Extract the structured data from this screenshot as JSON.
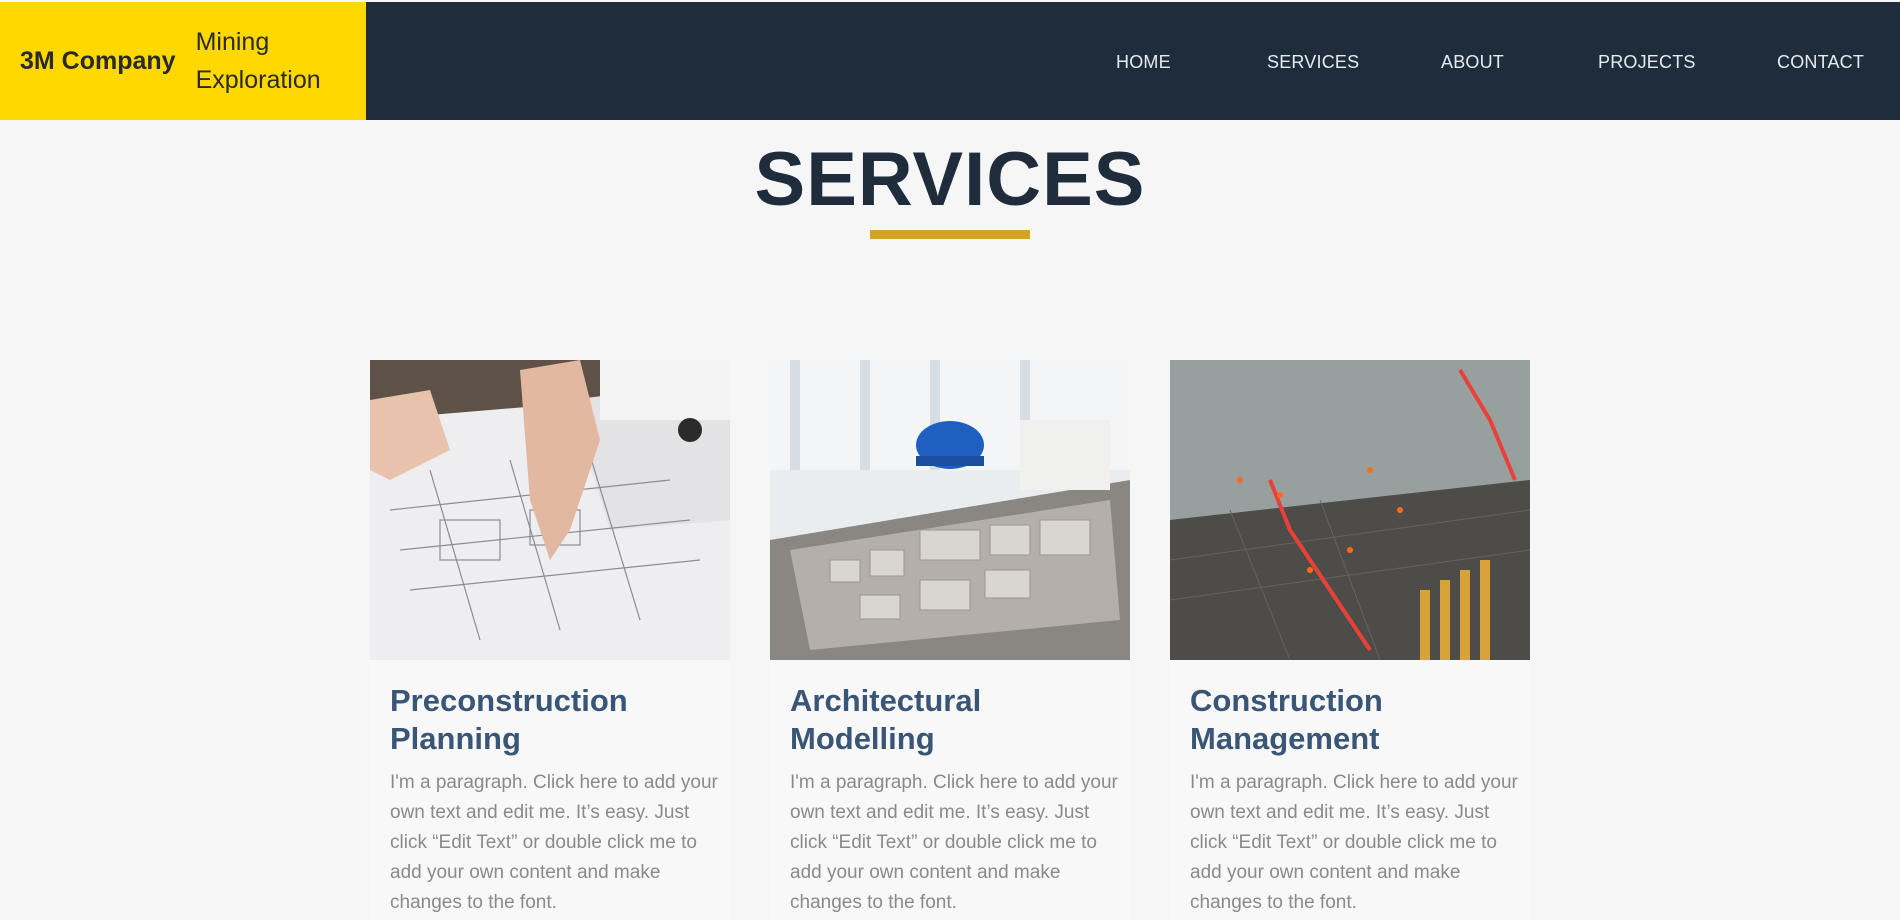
{
  "brand": {
    "name": "3M Company",
    "tagline": "Mining\nExploration"
  },
  "nav": {
    "items": [
      "HOME",
      "SERVICES",
      "ABOUT",
      "PROJECTS",
      "CONTACT"
    ]
  },
  "page": {
    "title": "SERVICES"
  },
  "cards": [
    {
      "title": "Preconstruction\nPlanning",
      "text": "I'm a paragraph. Click here to add your own text and edit me. It’s easy. Just click “Edit Text” or double click me to add your own content and make changes to the font."
    },
    {
      "title": "Architectural\nModelling",
      "text": "I'm a paragraph. Click here to add your own text and edit me. It’s easy. Just click “Edit Text” or double click me to add your own content and make changes to the font."
    },
    {
      "title": "Construction\nManagement",
      "text": "I'm a paragraph. Click here to add your own text and edit me. It’s easy. Just click “Edit Text” or double click me to add your own content and make changes to the font."
    }
  ],
  "colors": {
    "header_bg": "#1e2c3c",
    "brand_bg": "#ffd800",
    "accent_underline": "#d4a523",
    "card_title": "#3a5676",
    "paragraph": "#8a8a8a"
  }
}
